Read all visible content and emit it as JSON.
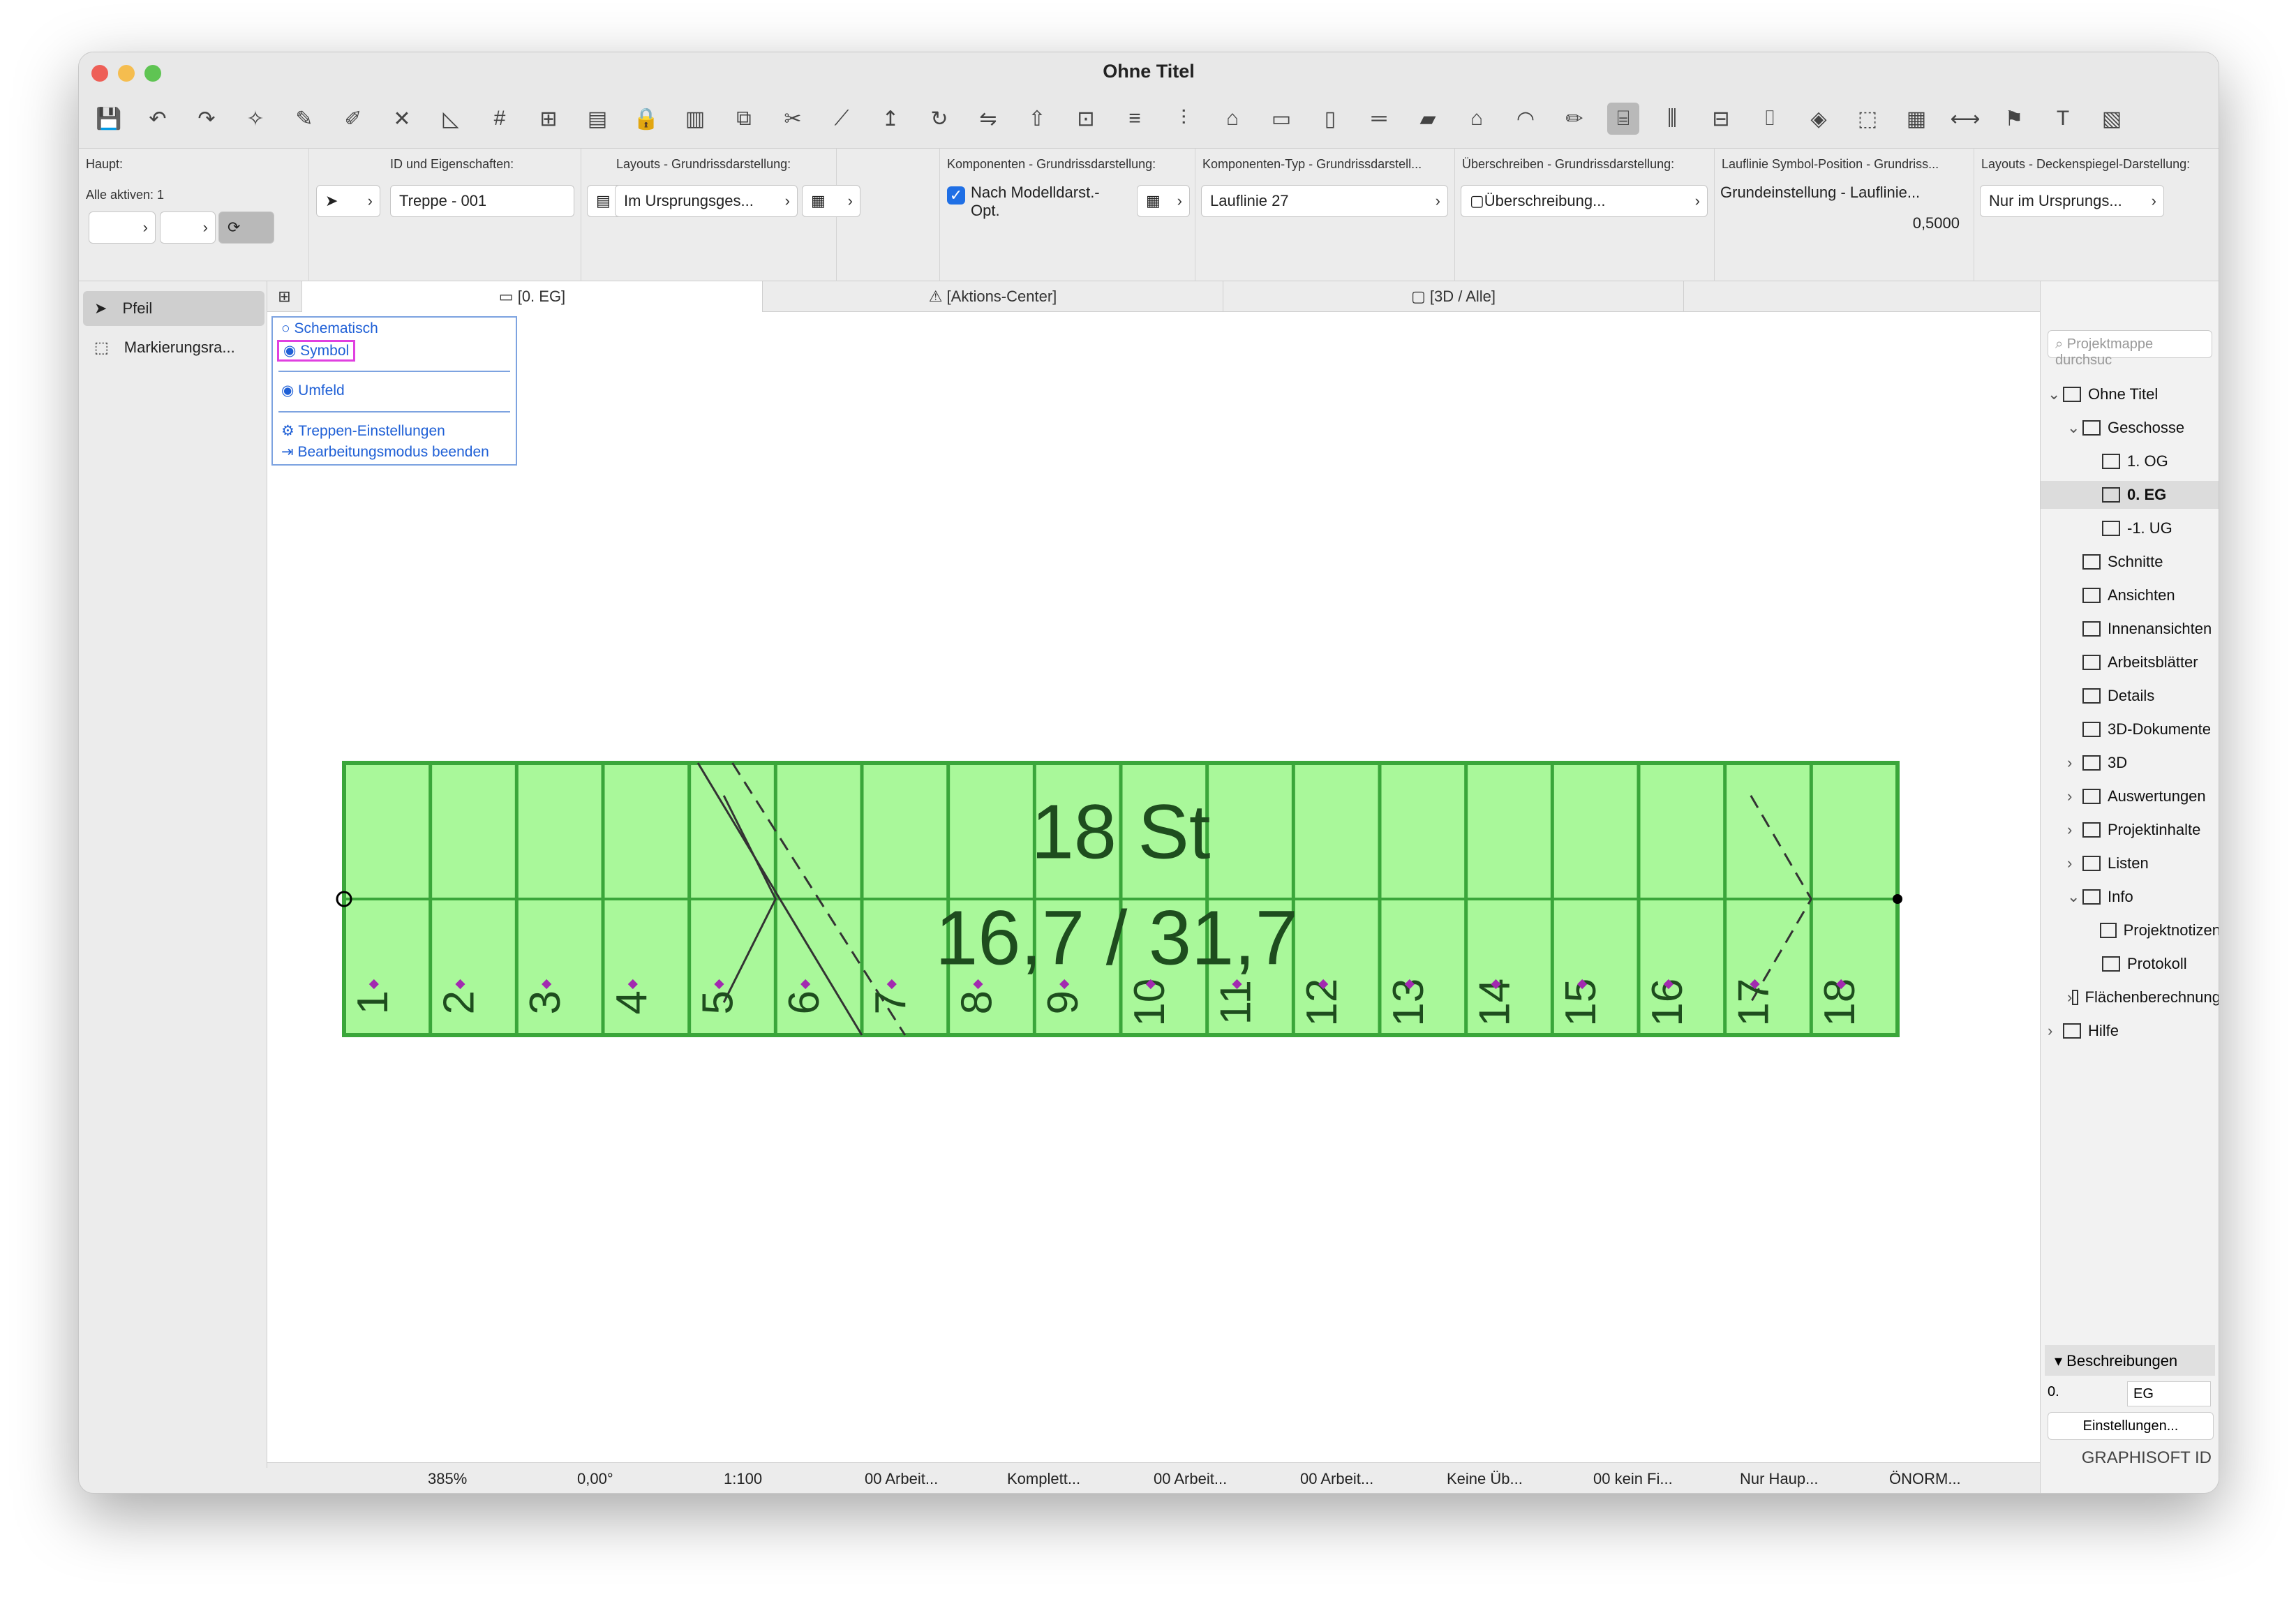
{
  "window": {
    "title": "Ohne Titel"
  },
  "toolbar_icons": [
    "save-icon",
    "undo-icon",
    "redo-icon",
    "magic-wand-icon",
    "eyedropper-icon",
    "inject-icon",
    "snap-guide-icon",
    "ruler-icon",
    "grid-icon",
    "grid-snap-icon",
    "layers-icon",
    "lock-icon",
    "renovation-icon",
    "group-icon",
    "trim-icon",
    "split-icon",
    "move-icon",
    "rotate-icon",
    "mirror-icon",
    "elevate-icon",
    "offset-icon",
    "align-icon",
    "distribute-icon",
    "section-icon",
    "wall-icon",
    "column-icon",
    "beam-icon",
    "slab-icon",
    "roof-icon",
    "shell-icon",
    "measure-icon",
    "stair-icon",
    "railing-icon",
    "window-icon",
    "door-icon",
    "object-icon",
    "zone-icon",
    "mesh-icon",
    "dimension-icon",
    "label-icon",
    "text-icon",
    "fill-icon"
  ],
  "infobox": {
    "haupt_label": "Haupt:",
    "alle_aktiven": "Alle aktiven: 1",
    "id_label": "ID und Eigenschaften:",
    "id_value": "Treppe - 001",
    "layouts_label": "Layouts - Grundrissdarstellung:",
    "layouts_value": "Im Ursprungsges...",
    "komponenten_label": "Komponenten - Grundrissdarstellung:",
    "komponenten_value": "Nach Modelldarst.-Opt.",
    "komponenten_typ_label": "Komponenten-Typ - Grundrissdarstell...",
    "komponenten_typ_value": "Lauflinie 27",
    "ueberschreiben_label": "Überschreiben - Grundrissdarstellung:",
    "ueberschreiben_value": "Überschreibung...",
    "lauflinie_label": "Lauflinie Symbol-Position - Grundriss...",
    "lauflinie_value": "Grundeinstellung - Lauflinie...",
    "lauflinie_num": "0,5000",
    "decken_label": "Layouts - Deckenspiegel-Darstellung:",
    "decken_value": "Nur im Ursprungs...",
    "komp2_label": "Kompone",
    "komp2_value": "Nach Opt."
  },
  "left_palette": {
    "items": [
      {
        "label": "Pfeil"
      },
      {
        "label": "Markierungsra..."
      }
    ]
  },
  "tabs": [
    {
      "label": "[0. EG]"
    },
    {
      "label": "[Aktions-Center]"
    },
    {
      "label": "[3D / Alle]"
    }
  ],
  "context_menu": {
    "schematisch": "Schematisch",
    "symbol": "Symbol",
    "umfeld": "Umfeld",
    "treppen_einstellungen": "Treppen-Einstellungen",
    "bearbeitungsmodus": "Bearbeitungsmodus beenden"
  },
  "stair": {
    "steps_label": "18 St",
    "ratio_label": "16,7 / 31,7",
    "step_numbers": [
      "1",
      "2",
      "3",
      "4",
      "5",
      "6",
      "7",
      "8",
      "9",
      "10",
      "11",
      "12",
      "13",
      "14",
      "15",
      "16",
      "17",
      "18"
    ]
  },
  "navigator": {
    "search_placeholder": "Projektmappe durchsuc",
    "items": [
      {
        "label": "Ohne Titel"
      },
      {
        "label": "Geschosse"
      },
      {
        "label": "1. OG"
      },
      {
        "label": "0. EG"
      },
      {
        "label": "-1. UG"
      },
      {
        "label": "Schnitte"
      },
      {
        "label": "Ansichten"
      },
      {
        "label": "Innenansichten"
      },
      {
        "label": "Arbeitsblätter"
      },
      {
        "label": "Details"
      },
      {
        "label": "3D-Dokumente"
      },
      {
        "label": "3D"
      },
      {
        "label": "Auswertungen"
      },
      {
        "label": "Projektinhalte"
      },
      {
        "label": "Listen"
      },
      {
        "label": "Info"
      },
      {
        "label": "Projektnotizen"
      },
      {
        "label": "Protokoll"
      },
      {
        "label": "Flächenberechnung"
      },
      {
        "label": "Hilfe"
      }
    ],
    "beschreibungen": "Beschreibungen",
    "desc_id": "0.",
    "desc_value": "EG",
    "einstellungen": "Einstellungen...",
    "graphisoft": "GRAPHISOFT ID"
  },
  "statusbar": {
    "zoom": "385%",
    "angle": "0,00°",
    "scale": "1:100",
    "layer": "00 Arbeit...",
    "model": "Komplett...",
    "pen": "00 Arbeit...",
    "view": "00 Arbeit...",
    "override": "Keine Üb...",
    "filter": "00 kein Fi...",
    "struct": "Nur Haup...",
    "dim": "ÖNORM..."
  },
  "colors": {
    "stair_fill": "#a9f89a",
    "stair_stroke": "#3aa63a",
    "highlight": "#e040e0",
    "accent": "#1f6fe5"
  }
}
